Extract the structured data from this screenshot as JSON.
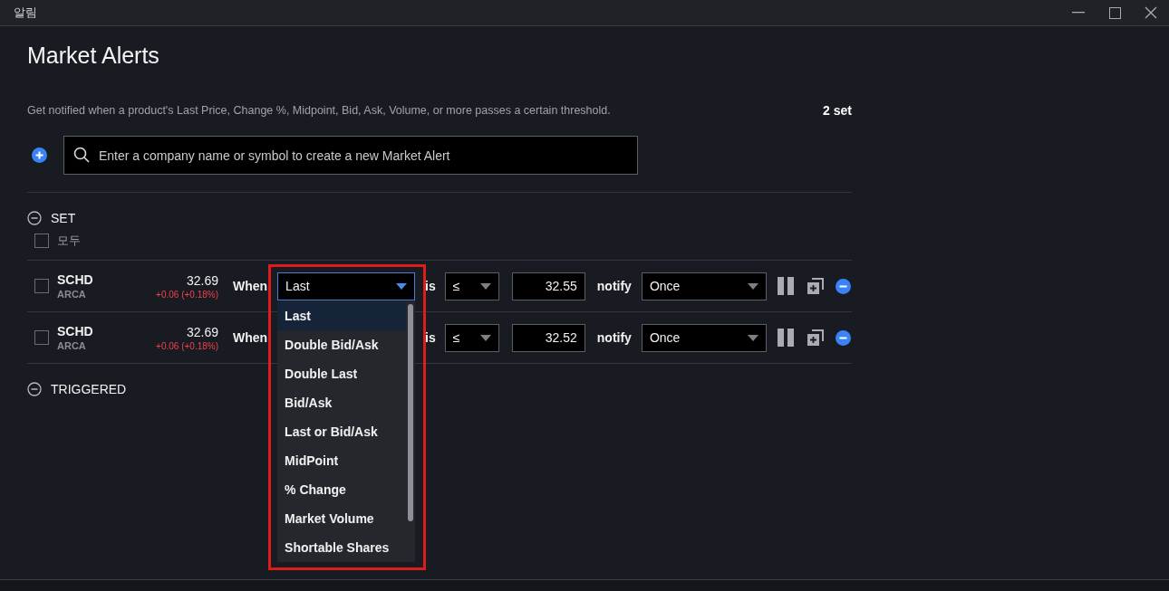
{
  "window": {
    "title": "알림"
  },
  "heading": "Market Alerts",
  "description": "Get notified when a product's Last Price, Change %, Midpoint, Bid, Ask, Volume, or more passes a certain threshold.",
  "count": "2 set",
  "search": {
    "placeholder": "Enter a company name or symbol to create a new Market Alert"
  },
  "sections": [
    {
      "label": "SET",
      "expanded": true,
      "select_all": {
        "label": "모두",
        "checked": false
      },
      "alerts": [
        {
          "symbol": "SCHD",
          "exchange": "ARCA",
          "price": "32.69",
          "change": "+0.06 (+0.18%)",
          "when_label": "When",
          "field": "Last",
          "open": true,
          "options": [
            {
              "label": "Last",
              "selected": true
            },
            {
              "label": "Double Bid/Ask",
              "selected": false
            },
            {
              "label": "Double Last",
              "selected": false
            },
            {
              "label": "Bid/Ask",
              "selected": false
            },
            {
              "label": "Last or Bid/Ask",
              "selected": false
            },
            {
              "label": "MidPoint",
              "selected": false
            },
            {
              "label": "% Change",
              "selected": false
            },
            {
              "label": "Market Volume",
              "selected": false
            },
            {
              "label": "Shortable Shares",
              "selected": false
            }
          ],
          "is_label": "is",
          "operator": "≤",
          "threshold": "32.55",
          "notify_label": "notify",
          "frequency": "Once",
          "checked": false
        },
        {
          "symbol": "SCHD",
          "exchange": "ARCA",
          "price": "32.69",
          "change": "+0.06 (+0.18%)",
          "when_label": "When",
          "open": false,
          "is_label": "is",
          "operator": "≤",
          "threshold": "32.52",
          "notify_label": "notify",
          "frequency": "Once",
          "checked": false
        }
      ]
    },
    {
      "label": "TRIGGERED",
      "expanded": true
    }
  ]
}
